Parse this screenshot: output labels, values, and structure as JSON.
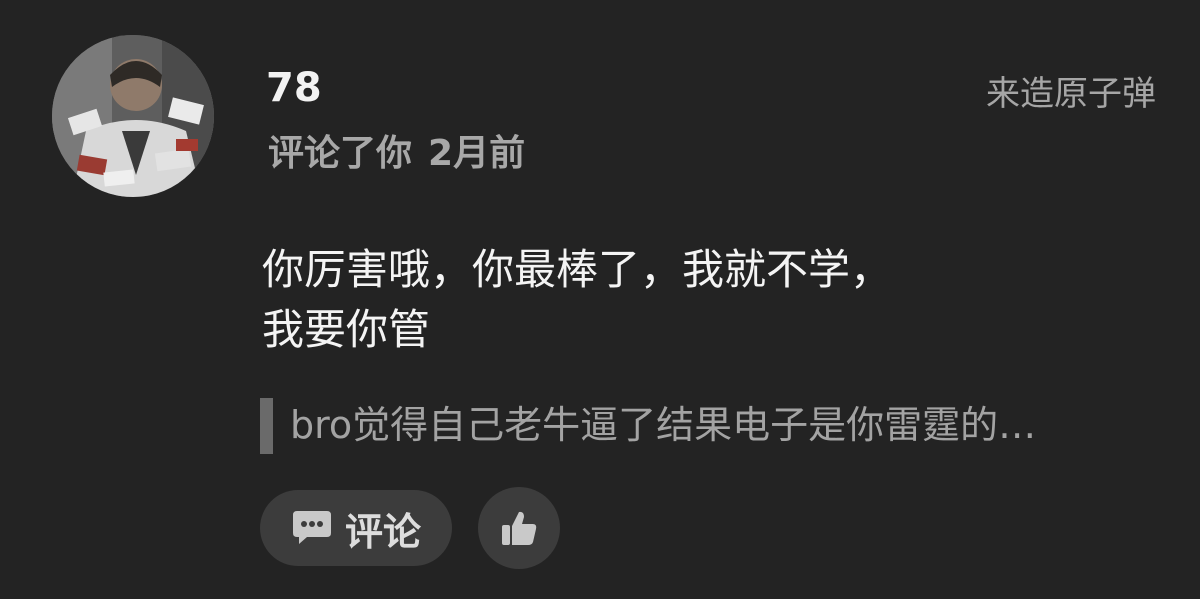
{
  "comment": {
    "username": "78",
    "action": "评论了你",
    "time": "2月前",
    "post_title": "来造原子弹",
    "text": "你厉害哦，你最棒了，我就不学，我要你管",
    "quoted": "bro觉得自己老牛逼了结果电子是你雷霆的…"
  },
  "actions": {
    "reply_label": "评论",
    "reply_icon": "comment-bubble-icon",
    "like_icon": "thumbs-up-icon"
  },
  "colors": {
    "background": "#232323",
    "button_bg": "#3c3c3c",
    "muted_text": "#a8a8a8"
  }
}
